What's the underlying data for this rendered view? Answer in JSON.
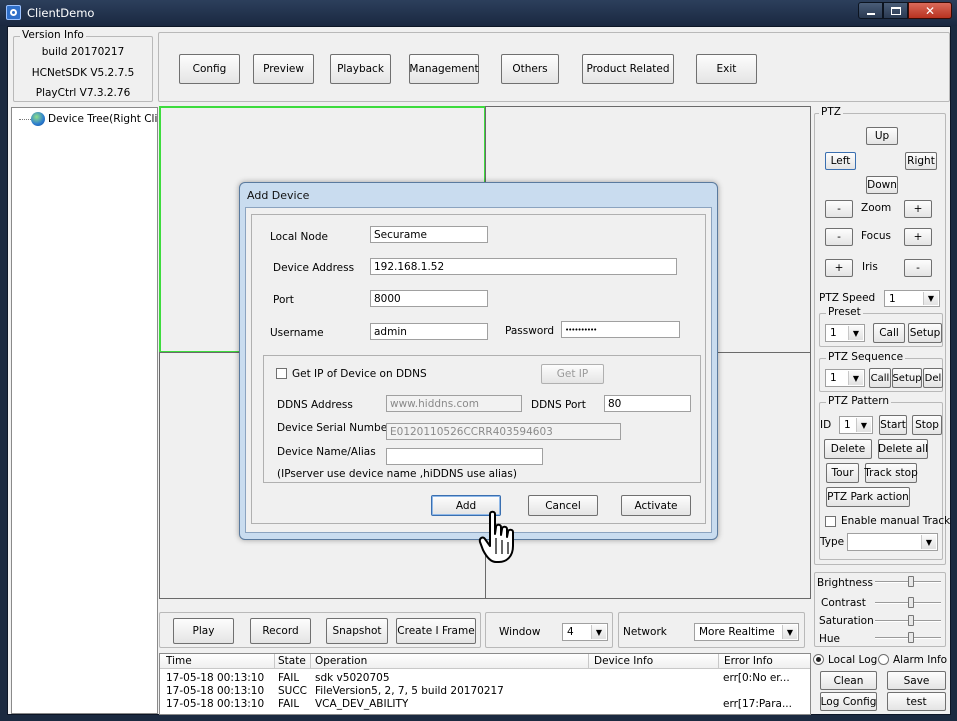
{
  "window": {
    "title": "ClientDemo"
  },
  "version_info": {
    "caption": "Version Info",
    "build": "build 20170217",
    "sdk": "HCNetSDK V5.2.7.5",
    "playctrl": "PlayCtrl V7.3.2.76"
  },
  "toolbar": [
    "Config",
    "Preview",
    "Playback",
    "Management",
    "Others",
    "Product Related",
    "Exit"
  ],
  "tree": {
    "root_label": "Device Tree(Right Click t"
  },
  "dialog": {
    "title": "Add Device",
    "local_node_label": "Local Node",
    "local_node_value": "Securame",
    "device_address_label": "Device Address",
    "device_address_value": "192.168.1.52",
    "port_label": "Port",
    "port_value": "8000",
    "username_label": "Username",
    "username_value": "admin",
    "password_label": "Password",
    "password_value": "••••••••••",
    "ddns_checkbox_label": "Get IP of Device on DDNS",
    "get_ip_label": "Get IP",
    "ddns_address_label": "DDNS Address",
    "ddns_address_value": "www.hiddns.com",
    "ddns_port_label": "DDNS Port",
    "ddns_port_value": "80",
    "serial_label": "Device Serial Number",
    "serial_value": "E0120110526CCRR403594603",
    "alias_label": "Device Name/Alias",
    "alias_value": "",
    "note": "(IPserver use device name ,hiDDNS use alias)",
    "add_label": "Add",
    "cancel_label": "Cancel",
    "activate_label": "Activate"
  },
  "ptz": {
    "caption": "PTZ",
    "up": "Up",
    "left": "Left",
    "right": "Right",
    "down": "Down",
    "minus": "-",
    "plus": "+",
    "zoom": "Zoom",
    "focus": "Focus",
    "iris": "Iris",
    "speed_label": "PTZ Speed",
    "speed_value": "1",
    "preset_caption": "Preset",
    "preset_value": "1",
    "call": "Call",
    "setup": "Setup",
    "sequence_caption": "PTZ Sequence",
    "sequence_value": "1",
    "del": "Del",
    "pattern_caption": "PTZ Pattern",
    "id_label": "ID",
    "pattern_value": "1",
    "start": "Start",
    "stop": "Stop",
    "delete": "Delete",
    "delete_all": "Delete all",
    "tour": "Tour",
    "track_stop": "Track stop",
    "park_action": "PTZ Park action",
    "enable_manual_track": "Enable manual Track",
    "type_label": "Type",
    "type_value": ""
  },
  "image": {
    "brightness": "Brightness",
    "contrast": "Contrast",
    "saturation": "Saturation",
    "hue": "Hue",
    "levels": {
      "brightness": 0.55,
      "contrast": 0.55,
      "saturation": 0.55,
      "hue": 0.55
    }
  },
  "log": {
    "local_log": "Local Log",
    "alarm_info": "Alarm Info",
    "clean": "Clean",
    "save": "Save",
    "log_config": "Log Config",
    "test": "test",
    "headers": [
      "Time",
      "State",
      "Operation",
      "Device Info",
      "Error Info"
    ],
    "rows": [
      [
        "17-05-18 00:13:10",
        "FAIL",
        "sdk v5020705",
        "",
        "err[0:No er..."
      ],
      [
        "17-05-18 00:13:10",
        "SUCC",
        "FileVersion5, 2, 7, 5 build 20170217",
        "",
        ""
      ],
      [
        "17-05-18 00:13:10",
        "FAIL",
        "VCA_DEV_ABILITY",
        "",
        "err[17:Para..."
      ]
    ]
  },
  "bottom": {
    "play": "Play",
    "record": "Record",
    "snapshot": "Snapshot",
    "create_i_frame": "Create I Frame",
    "window_label": "Window",
    "window_value": "4",
    "network_label": "Network",
    "network_value": "More Realtime"
  }
}
